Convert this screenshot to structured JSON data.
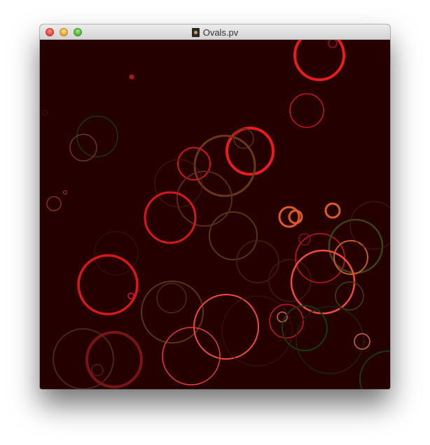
{
  "window": {
    "title": "Ovals.pv",
    "title_icon": "document-icon",
    "background": "#250000",
    "buttons": [
      "close",
      "minimize",
      "zoom"
    ]
  },
  "canvas": {
    "description_colors": {
      "bright_red": "#e81c1c",
      "red": "#c81818",
      "dark_red": "#7a1414",
      "salmon": "#f04a3c",
      "orange": "#e05a28",
      "brown": "#6a3818",
      "olive": "#3a4418",
      "dark_green": "#163814"
    }
  }
}
